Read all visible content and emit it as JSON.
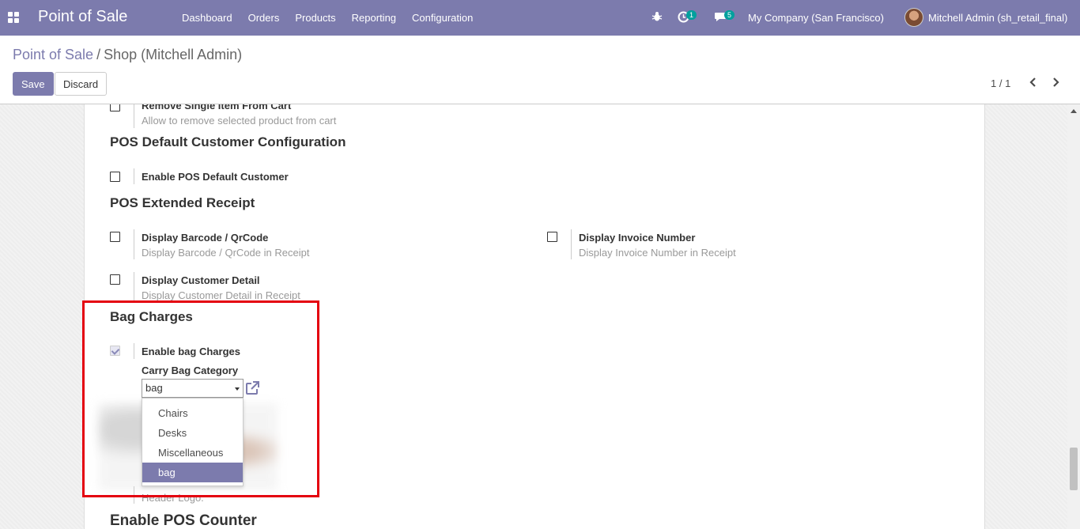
{
  "navbar": {
    "brand": "Point of Sale",
    "menu": [
      "Dashboard",
      "Orders",
      "Products",
      "Reporting",
      "Configuration"
    ],
    "activity_count": "1",
    "message_count": "5",
    "company": "My Company (San Francisco)",
    "user": "Mitchell Admin (sh_retail_final)"
  },
  "breadcrumb": {
    "parent": "Point of Sale",
    "separator": "/",
    "current": "Shop (Mitchell Admin)"
  },
  "buttons": {
    "save": "Save",
    "discard": "Discard"
  },
  "pager": "1 / 1",
  "sections": {
    "remove_item": {
      "title": "Remove Single Item From Cart",
      "desc": "Allow to remove selected product from cart"
    },
    "default_customer": {
      "heading": "POS Default Customer Configuration",
      "title": "Enable POS Default Customer"
    },
    "extended_receipt": {
      "heading": "POS Extended Receipt",
      "barcode_title": "Display Barcode / QrCode",
      "barcode_desc": "Display Barcode / QrCode in Receipt",
      "invoice_title": "Display Invoice Number",
      "invoice_desc": "Display Invoice Number in Receipt",
      "customer_title": "Display Customer Detail",
      "customer_desc": "Display Customer Detail in Receipt"
    },
    "bag_charges": {
      "heading": "Bag Charges",
      "title": "Enable bag Charges",
      "checked": true,
      "category_label": "Carry Bag Category",
      "category_value": "bag",
      "options": [
        "Chairs",
        "Desks",
        "Miscellaneous",
        "bag"
      ],
      "selected_option": "bag"
    },
    "header_logo_desc": "Header Logo.",
    "pos_counter": {
      "heading": "Enable POS Counter"
    }
  },
  "colors": {
    "brand": "#7c7bad",
    "highlight": "#e4000f",
    "badge": "#00a09d"
  }
}
